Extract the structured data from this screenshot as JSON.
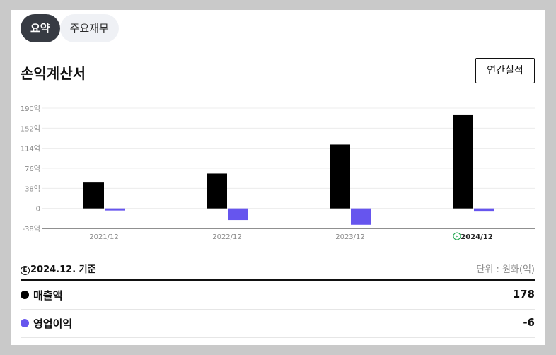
{
  "tabs": [
    {
      "label": "요약",
      "active": true
    },
    {
      "label": "주요재무",
      "active": false
    }
  ],
  "section_title": "손익계산서",
  "annual_button": "연간실적",
  "basis_mark": "E",
  "basis_text": "2024.12. 기준",
  "unit_text": "단위 : 원화(억)",
  "colors": {
    "revenue": "#000000",
    "operating_income": "#6655ee",
    "estimate": "#1aa34a"
  },
  "chart_data": {
    "type": "bar",
    "categories": [
      "2021/12",
      "2022/12",
      "2023/12",
      "2024/12"
    ],
    "estimate_flags": [
      false,
      false,
      false,
      true
    ],
    "estimate_mark": "E",
    "series": [
      {
        "name": "매출액",
        "values": [
          49,
          66,
          121,
          178
        ]
      },
      {
        "name": "영업이익",
        "values": [
          -4,
          -22,
          -31,
          -6
        ]
      }
    ],
    "y_ticks": [
      "190억",
      "152억",
      "114억",
      "76억",
      "38억",
      "0",
      "-38억"
    ],
    "ylim": [
      -38,
      190
    ],
    "grid": true,
    "legend": "below"
  },
  "summary_rows": [
    {
      "label": "매출액",
      "value": "178"
    },
    {
      "label": "영업이익",
      "value": "-6"
    }
  ]
}
